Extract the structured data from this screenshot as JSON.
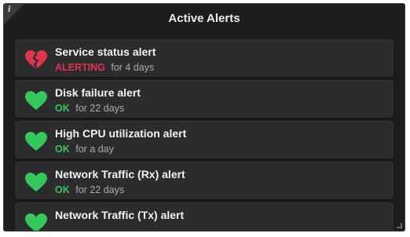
{
  "panel": {
    "title": "Active Alerts",
    "info_icon": "i"
  },
  "colors": {
    "background": "#1d1d1f",
    "row_background": "#2c2c2f",
    "alerting": "#e0344e",
    "ok": "#36c75a",
    "muted": "#a9a9ac"
  },
  "alerts": [
    {
      "name": "Service status alert",
      "state": "ALERTING",
      "duration": "for 4 days",
      "icon": "broken-heart-icon",
      "color": "#e0344e"
    },
    {
      "name": "Disk failure alert",
      "state": "OK",
      "duration": "for 22 days",
      "icon": "heart-icon",
      "color": "#36c75a"
    },
    {
      "name": "High CPU utilization alert",
      "state": "OK",
      "duration": "for a day",
      "icon": "heart-icon",
      "color": "#36c75a"
    },
    {
      "name": "Network Traffic (Rx) alert",
      "state": "OK",
      "duration": "for 22 days",
      "icon": "heart-icon",
      "color": "#36c75a"
    },
    {
      "name": "Network Traffic (Tx) alert",
      "state": "",
      "duration": "",
      "icon": "heart-icon",
      "color": "#36c75a"
    }
  ]
}
